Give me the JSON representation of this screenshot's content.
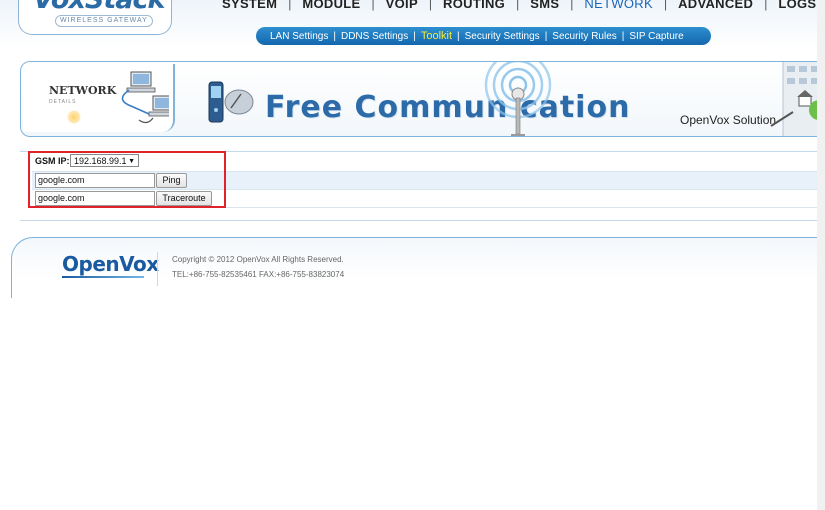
{
  "brand": {
    "name": "VoxStack",
    "subtitle": "WIRELESS GATEWAY"
  },
  "main_nav": [
    {
      "label": "SYSTEM",
      "active": false
    },
    {
      "label": "MODULE",
      "active": false
    },
    {
      "label": "VOIP",
      "active": false
    },
    {
      "label": "ROUTING",
      "active": false
    },
    {
      "label": "SMS",
      "active": false
    },
    {
      "label": "NETWORK",
      "active": true
    },
    {
      "label": "ADVANCED",
      "active": false
    },
    {
      "label": "LOGS",
      "active": false
    }
  ],
  "sub_nav": [
    {
      "label": "LAN Settings",
      "active": false
    },
    {
      "label": "DDNS Settings",
      "active": false
    },
    {
      "label": "Toolkit",
      "active": true
    },
    {
      "label": "Security Settings",
      "active": false
    },
    {
      "label": "Security Rules",
      "active": false
    },
    {
      "label": "SIP Capture",
      "active": false
    }
  ],
  "banner": {
    "section_title": "NETWORK",
    "section_subtitle": "DETAILS",
    "slogan": "Free Commun   cation",
    "solution": "OpenVox Solution"
  },
  "toolkit": {
    "gsm_ip_label": "GSM IP:",
    "gsm_ip_value": "192.168.99.1",
    "ping_target": "google.com",
    "ping_button": "Ping",
    "traceroute_target": "google.com",
    "traceroute_button": "Traceroute"
  },
  "footer": {
    "logo": "OpenVox",
    "copyright": "Copyright © 2012 OpenVox All Rights Reserved.",
    "contact": "TEL:+86-755-82535461 FAX:+86-755-83823074"
  },
  "colors": {
    "accent": "#1b66b6",
    "subnav_bg": "#1f7cc1",
    "subnav_active": "#f6ea3a",
    "highlight_box": "#e0232a",
    "row_alt": "#e8f1f9"
  }
}
